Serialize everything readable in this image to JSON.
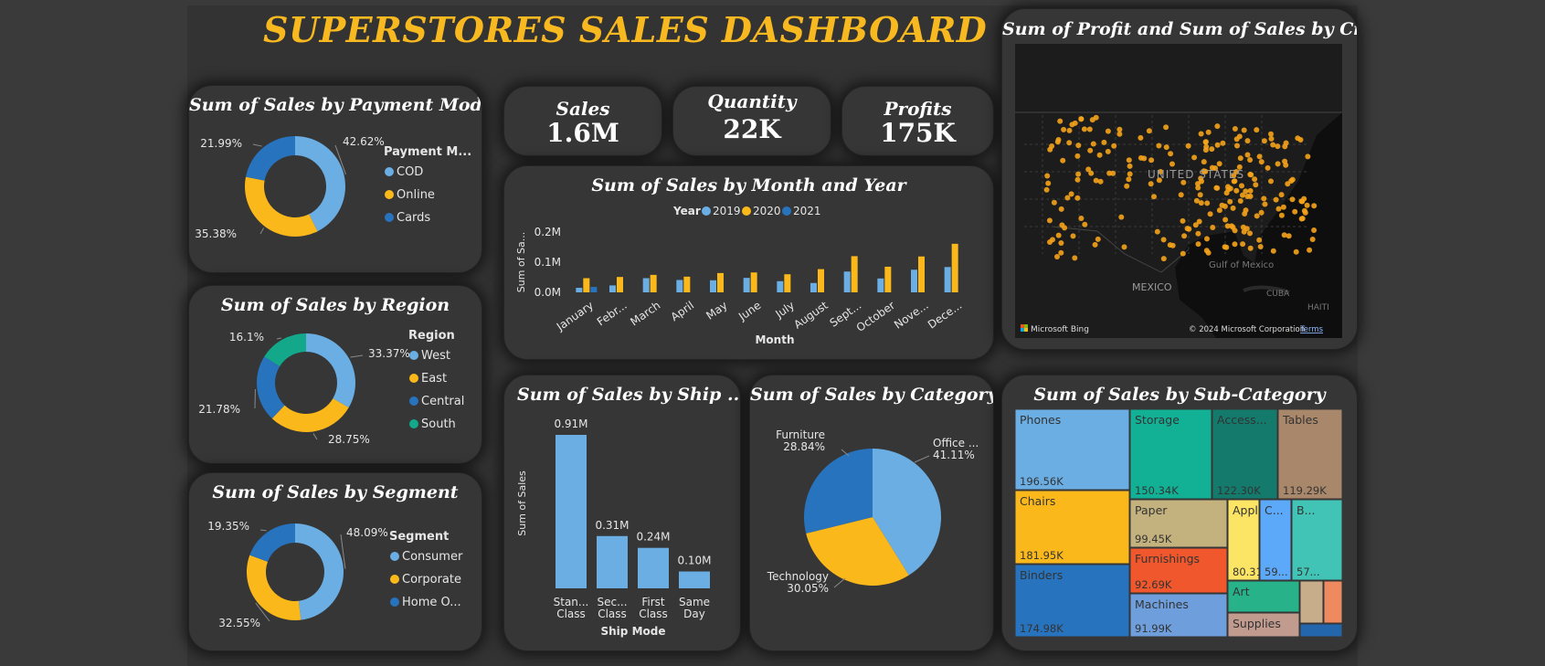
{
  "dashboard": {
    "title": "SUPERSTORES SALES DASHBOARD"
  },
  "colors": {
    "c2019": "#6aaee3",
    "c2020": "#fbb81b",
    "c2021": "#2873bd",
    "teal": "#14a88a",
    "title": "#f8b820"
  },
  "kpis": [
    {
      "label": "Sales",
      "value": "1.6M"
    },
    {
      "label": "Quantity",
      "value": "22K"
    },
    {
      "label": "Profits",
      "value": "175K"
    }
  ],
  "map": {
    "title": "Sum of Profit and Sum of Sales by City",
    "labels": {
      "us": "UNITED STATES",
      "mexico": "MEXICO",
      "gulf": "Gulf of Mexico",
      "cuba": "CUBA",
      "haiti": "HAITI"
    },
    "attribution": {
      "bing": "Microsoft Bing",
      "copyright": "© 2024 Microsoft Corporation",
      "terms": "Terms"
    }
  },
  "chart_data": [
    {
      "id": "payment",
      "type": "pie",
      "title": "Sum of Sales by Payment Mode",
      "legend_title": "Payment M...",
      "categories": [
        "COD",
        "Online",
        "Cards"
      ],
      "values": [
        42.62,
        35.38,
        21.99
      ],
      "labels": [
        "42.62%",
        "35.38%",
        "21.99%"
      ],
      "colors": [
        "#6aaee3",
        "#fbb81b",
        "#2873bd"
      ]
    },
    {
      "id": "region",
      "type": "pie",
      "title": "Sum of Sales by Region",
      "legend_title": "Region",
      "categories": [
        "West",
        "East",
        "Central",
        "South"
      ],
      "values": [
        33.37,
        28.75,
        21.78,
        16.1
      ],
      "labels": [
        "33.37%",
        "28.75%",
        "21.78%",
        "16.1%"
      ],
      "colors": [
        "#6aaee3",
        "#fbb81b",
        "#2873bd",
        "#14a88a"
      ]
    },
    {
      "id": "segment",
      "type": "pie",
      "title": "Sum of Sales by Segment",
      "legend_title": "Segment",
      "categories": [
        "Consumer",
        "Corporate",
        "Home O..."
      ],
      "values": [
        48.09,
        32.55,
        19.35
      ],
      "labels": [
        "48.09%",
        "32.55%",
        "19.35%"
      ],
      "colors": [
        "#6aaee3",
        "#fbb81b",
        "#2873bd"
      ]
    },
    {
      "id": "monthly",
      "type": "bar",
      "title": "Sum of Sales by Month and Year",
      "legend_title": "Year",
      "xlabel": "Month",
      "ylabel": "Sum of Sa...",
      "yticks": [
        "0.0M",
        "0.1M",
        "0.2M"
      ],
      "ylim": [
        0,
        0.2
      ],
      "categories": [
        "January",
        "Febr...",
        "March",
        "April",
        "May",
        "June",
        "July",
        "August",
        "Sept...",
        "October",
        "Nove...",
        "Dece..."
      ],
      "series": [
        {
          "name": "2019",
          "color": "#6aaee3",
          "values": [
            0.015,
            0.023,
            0.047,
            0.041,
            0.04,
            0.048,
            0.037,
            0.031,
            0.069,
            0.046,
            0.075,
            0.084
          ]
        },
        {
          "name": "2020",
          "color": "#fbb81b",
          "values": [
            0.047,
            0.051,
            0.058,
            0.052,
            0.064,
            0.066,
            0.06,
            0.077,
            0.12,
            0.085,
            0.119,
            0.161
          ]
        },
        {
          "name": "2021",
          "color": "#2873bd",
          "values": [
            0.018,
            0,
            0,
            0,
            0,
            0,
            0,
            0,
            0,
            0,
            0,
            0
          ]
        }
      ]
    },
    {
      "id": "shipmode",
      "type": "bar",
      "title": "Sum of Sales by Ship ...",
      "xlabel": "Ship Mode",
      "ylabel": "Sum of Sales",
      "categories": [
        [
          "Stan...",
          "Class"
        ],
        [
          "Sec...",
          "Class"
        ],
        [
          "First",
          "Class"
        ],
        [
          "Same",
          "Day"
        ]
      ],
      "values": [
        0.91,
        0.31,
        0.24,
        0.1
      ],
      "labels": [
        "0.91M",
        "0.31M",
        "0.24M",
        "0.10M"
      ],
      "color": "#6aaee3"
    },
    {
      "id": "category",
      "type": "pie",
      "title": "Sum of Sales by Category",
      "categories": [
        "Office ...",
        "Technology",
        "Furniture"
      ],
      "values": [
        41.11,
        30.05,
        28.84
      ],
      "labels": [
        "41.11%",
        "30.05%",
        "28.84%"
      ],
      "colors": [
        "#6aaee3",
        "#fbb81b",
        "#2873bd"
      ]
    },
    {
      "id": "subcategory",
      "type": "treemap",
      "title": "Sum of Sales by Sub-Category",
      "items": [
        {
          "name": "Phones",
          "value": "196.56K",
          "color": "#6aaee3"
        },
        {
          "name": "Chairs",
          "value": "181.95K",
          "color": "#fbb81b"
        },
        {
          "name": "Binders",
          "value": "174.98K",
          "color": "#2873bd"
        },
        {
          "name": "Storage",
          "value": "150.34K",
          "color": "#12b196"
        },
        {
          "name": "Access...",
          "value": "122.30K",
          "color": "#137a6c"
        },
        {
          "name": "Tables",
          "value": "119.29K",
          "color": "#a9876a"
        },
        {
          "name": "Paper",
          "value": "99.45K",
          "color": "#c3b27e"
        },
        {
          "name": "Appl...",
          "value": "80.31K",
          "color": "#fce464"
        },
        {
          "name": "C...",
          "value": "59...",
          "color": "#5da9f9"
        },
        {
          "name": "B...",
          "value": "57...",
          "color": "#41c4b5"
        },
        {
          "name": "Furnishings",
          "value": "92.69K",
          "color": "#f0572c"
        },
        {
          "name": "Machines",
          "value": "91.99K",
          "color": "#6e9fdc"
        },
        {
          "name": "Art",
          "value": "",
          "color": "#27b28a"
        },
        {
          "name": "Supplies",
          "value": "",
          "color": "#c09b8e"
        },
        {
          "name": "",
          "value": "",
          "color": "#c8ad8a"
        },
        {
          "name": "",
          "value": "",
          "color": "#ef8a60"
        },
        {
          "name": "",
          "value": "",
          "color": "#2466ab"
        }
      ]
    }
  ]
}
